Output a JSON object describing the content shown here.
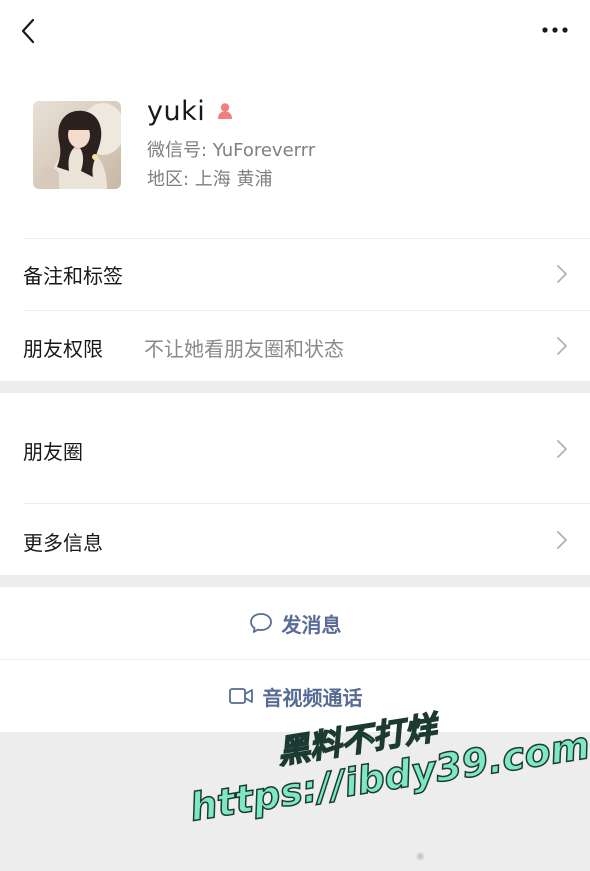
{
  "topbar": {
    "back_icon": "chevron-left-icon",
    "more_icon": "more-dots-icon"
  },
  "profile": {
    "name": "yuki",
    "gender_icon": "female-person-icon",
    "wechat_id": "微信号: YuForeverrr",
    "region": "地区: 上海 黄浦"
  },
  "rows": {
    "remark": {
      "label": "备注和标签"
    },
    "permissions": {
      "label": "朋友权限",
      "value": "不让她看朋友圈和状态"
    },
    "moments": {
      "label": "朋友圈"
    },
    "more_info": {
      "label": "更多信息"
    }
  },
  "actions": {
    "message": {
      "label": "发消息",
      "icon": "chat-bubble-icon"
    },
    "video_call": {
      "label": "音视频通话",
      "icon": "video-camera-icon"
    }
  },
  "watermark": {
    "line1": "黑料不打烊",
    "line2": "https://ibdy39.com"
  },
  "colors": {
    "link": "#576b95",
    "background": "#ededed",
    "card": "#ffffff",
    "gender": "#f37e7d"
  }
}
